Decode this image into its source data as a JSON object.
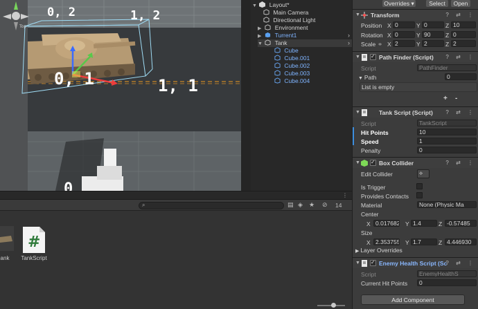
{
  "scene": {
    "grid_labels": [
      "0, 2",
      "1, 2",
      "0, 1",
      "1, 1"
    ]
  },
  "hierarchy": {
    "items": [
      {
        "label": "Layout*",
        "depth": 0,
        "icon": "unity-scene-icon",
        "expanded": true
      },
      {
        "label": "Main Camera",
        "depth": 1,
        "icon": "gameobject-icon"
      },
      {
        "label": "Directional Light",
        "depth": 1,
        "icon": "gameobject-icon"
      },
      {
        "label": "Environment",
        "depth": 1,
        "icon": "gameobject-icon",
        "collapsed": true
      },
      {
        "label": "Turrent1",
        "depth": 1,
        "icon": "prefab-icon",
        "collapsed": true,
        "prefab": true
      },
      {
        "label": "Tank",
        "depth": 1,
        "icon": "gameobject-icon",
        "expanded": true,
        "selected": true
      },
      {
        "label": "Cube",
        "depth": 2,
        "icon": "prefab-icon",
        "prefab": true
      },
      {
        "label": "Cube.001",
        "depth": 2,
        "icon": "prefab-icon",
        "prefab": true
      },
      {
        "label": "Cube.002",
        "depth": 2,
        "icon": "prefab-icon",
        "prefab": true
      },
      {
        "label": "Cube.003",
        "depth": 2,
        "icon": "prefab-icon",
        "prefab": true
      },
      {
        "label": "Cube.004",
        "depth": 2,
        "icon": "prefab-icon",
        "prefab": true
      }
    ]
  },
  "inspector": {
    "top": {
      "overrides": "Overrides",
      "select": "Select",
      "open": "Open"
    },
    "transform": {
      "title": "Transform",
      "position": {
        "label": "Position",
        "x": "0",
        "y": "0",
        "z": "10"
      },
      "rotation": {
        "label": "Rotation",
        "x": "0",
        "y": "90",
        "z": "0"
      },
      "scale": {
        "label": "Scale",
        "x": "2",
        "y": "2",
        "z": "2"
      }
    },
    "path_finder": {
      "title": "Path Finder (Script)",
      "script_label": "Script",
      "script_value": "PathFinder",
      "path_label": "Path",
      "path_count": "0",
      "empty_text": "List is empty",
      "plus": "+",
      "minus": "-"
    },
    "tank_script": {
      "title": "Tank Script (Script)",
      "script_label": "Script",
      "script_value": "TankScript",
      "hit_points_label": "Hit Points",
      "hit_points_value": "10",
      "speed_label": "Speed",
      "speed_value": "1",
      "penalty_label": "Penalty",
      "penalty_value": "0"
    },
    "box_collider": {
      "title": "Box Collider",
      "edit_collider": "Edit Collider",
      "is_trigger": "Is Trigger",
      "provides_contacts": "Provides Contacts",
      "material_label": "Material",
      "material_value": "None (Physic Ma",
      "center_label": "Center",
      "center": {
        "x": "0.017682",
        "y": "1.4",
        "z": "-0.57485"
      },
      "size_label": "Size",
      "size": {
        "x": "2.353755",
        "y": "1.7",
        "z": "4.446930"
      },
      "layer_overrides": "Layer Overrides"
    },
    "enemy_health": {
      "title": "Enemy Health Script (Sc",
      "script_label": "Script",
      "script_value": "EnemyHealthS",
      "current_hp_label": "Current Hit Points",
      "current_hp_value": "0"
    },
    "add_component": "Add Component"
  },
  "project": {
    "hidden_count": "14",
    "assets": [
      {
        "label": "ank",
        "icon": "prefab-icon"
      },
      {
        "label": "TankScript",
        "icon": "csharp-script-icon"
      }
    ]
  }
}
